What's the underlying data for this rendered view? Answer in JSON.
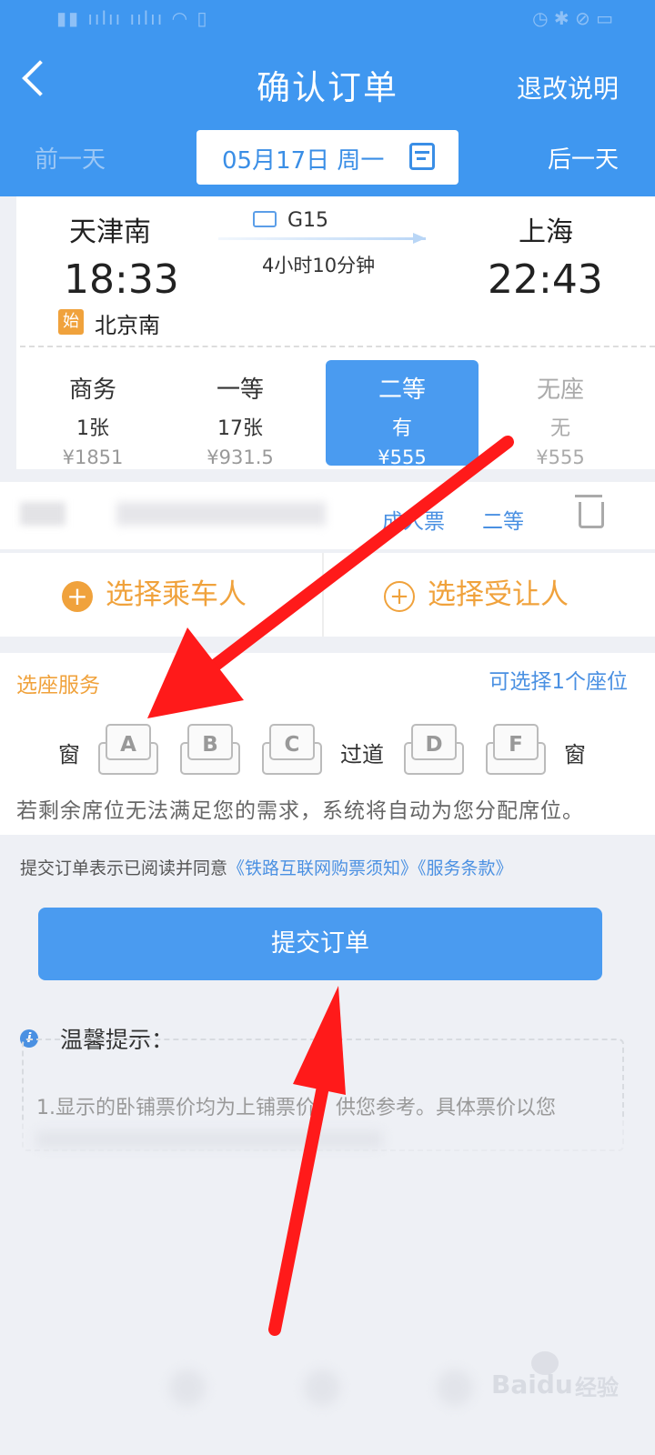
{
  "header": {
    "title": "确认订单",
    "refund_link": "退改说明",
    "prev_day": "前一天",
    "next_day": "后一天",
    "date": "05月17日 周一"
  },
  "train": {
    "from_station": "天津南",
    "to_station": "上海",
    "depart_time": "18:33",
    "arrive_time": "22:43",
    "origin_badge": "始",
    "origin_station": "北京南",
    "train_no": "G15",
    "duration": "4小时10分钟"
  },
  "seats": [
    {
      "name": "商务",
      "count": "1张",
      "price": "¥1851",
      "selected": false
    },
    {
      "name": "一等",
      "count": "17张",
      "price": "¥931.5",
      "selected": false
    },
    {
      "name": "二等",
      "count": "有",
      "price": "¥555",
      "selected": true
    },
    {
      "name": "无座",
      "count": "无",
      "price": "¥555",
      "selected": false
    }
  ],
  "passenger": {
    "ticket_type": "成人票",
    "seat_class": "二等"
  },
  "actions": {
    "choose_passenger": "选择乘车人",
    "choose_beneficiary": "选择受让人",
    "plus": "+"
  },
  "seat_service": {
    "title": "选座服务",
    "hint": "可选择1个座位",
    "window": "窗",
    "aisle": "过道",
    "seat_letters": [
      "A",
      "B",
      "C",
      "D",
      "F"
    ],
    "note": "若剩余席位无法满足您的需求，系统将自动为您分配席位。"
  },
  "agreement": {
    "prefix": "提交订单表示已阅读并同意",
    "link1": "《铁路互联网购票须知》",
    "link2": "《服务条款》"
  },
  "submit_label": "提交订单",
  "tips": {
    "icon_letter": "i",
    "title": "温馨提示：",
    "text": "1.显示的卧铺票价均为上铺票价，供您参考。具体票价以您"
  },
  "watermark": {
    "brand": "Baidu",
    "sub": "经验"
  },
  "annotation_color": "#ff1a1a",
  "accent_color": "#3f97f0",
  "icons": [
    "back-icon",
    "calendar-icon",
    "id-card-icon",
    "trash-icon",
    "plus-icon",
    "info-icon"
  ]
}
